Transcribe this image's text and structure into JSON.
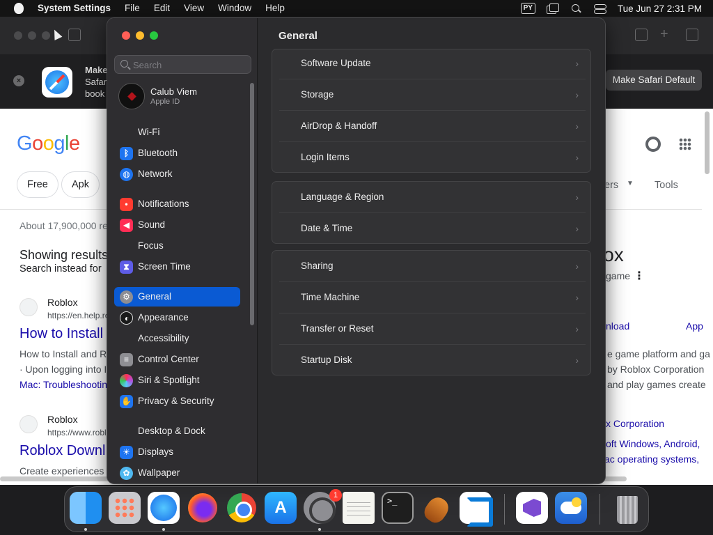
{
  "menubar": {
    "app_name": "System Settings",
    "items": [
      "File",
      "Edit",
      "View",
      "Window",
      "Help"
    ],
    "input_source": "PY",
    "clock": "Tue Jun 27  2:31 PM"
  },
  "safari": {
    "banner": {
      "line1": "Make",
      "line2": "Safar",
      "line3": "book",
      "button": "Make Safari Default"
    },
    "page": {
      "chips": [
        "Free",
        "Apk"
      ],
      "filters_partial": "ers",
      "tools": "Tools",
      "stats": "About 17,900,000 re",
      "showing": "Showing results",
      "search_instead": "Search instead for",
      "kp_title": "lox",
      "kp_sub": "game",
      "kp_links": [
        "nload",
        "App"
      ],
      "kp_lines": [
        "e game platform and ga",
        "by Roblox Corporation",
        "and play games create"
      ],
      "kp_corp": "x Corporation",
      "kp_os1": "oft Windows, Android,",
      "kp_os2": "ac operating systems,",
      "results": [
        {
          "site": "Roblox",
          "url": "https://en.help.ro",
          "title": "How to Install",
          "snippet1": "How to Install and R",
          "snippet2": "· Upon logging into I",
          "link": "Mac: Troubleshootin"
        },
        {
          "site": "Roblox",
          "url": "https://www.robl",
          "title": "Roblox Downl",
          "snippet1": "Create experiences"
        }
      ]
    }
  },
  "settings": {
    "search_placeholder": "Search",
    "profile": {
      "name": "Calub Viem",
      "sub": "Apple ID"
    },
    "sidebar": [
      {
        "label": "Wi-Fi",
        "icon": "wifi-icon"
      },
      {
        "label": "Bluetooth",
        "icon": "bluetooth-icon"
      },
      {
        "label": "Network",
        "icon": "network-globe-icon"
      },
      {
        "label": "Notifications",
        "icon": "bell-icon"
      },
      {
        "label": "Sound",
        "icon": "speaker-icon"
      },
      {
        "label": "Focus",
        "icon": "moon-icon"
      },
      {
        "label": "Screen Time",
        "icon": "hourglass-icon"
      },
      {
        "label": "General",
        "icon": "gear-icon"
      },
      {
        "label": "Appearance",
        "icon": "appearance-circle-icon"
      },
      {
        "label": "Accessibility",
        "icon": "accessibility-icon"
      },
      {
        "label": "Control Center",
        "icon": "toggles-icon"
      },
      {
        "label": "Siri & Spotlight",
        "icon": "siri-icon"
      },
      {
        "label": "Privacy & Security",
        "icon": "hand-icon"
      },
      {
        "label": "Desktop & Dock",
        "icon": "dock-icon"
      },
      {
        "label": "Displays",
        "icon": "sun-display-icon"
      },
      {
        "label": "Wallpaper",
        "icon": "wallpaper-flower-icon"
      }
    ],
    "selected": "General",
    "content_title": "General",
    "groups": [
      [
        "Software Update",
        "Storage",
        "AirDrop & Handoff",
        "Login Items"
      ],
      [
        "Language & Region",
        "Date & Time"
      ],
      [
        "Sharing",
        "Time Machine",
        "Transfer or Reset",
        "Startup Disk"
      ]
    ]
  },
  "dock": {
    "apps": [
      "Finder",
      "Launchpad",
      "Safari",
      "Firefox",
      "Google Chrome",
      "App Store",
      "System Settings",
      "TextEdit",
      "Terminal",
      "GarageBand",
      "Visual Studio Code",
      "Visual Studio",
      "Weather",
      "Trash"
    ],
    "settings_badge": "1"
  }
}
